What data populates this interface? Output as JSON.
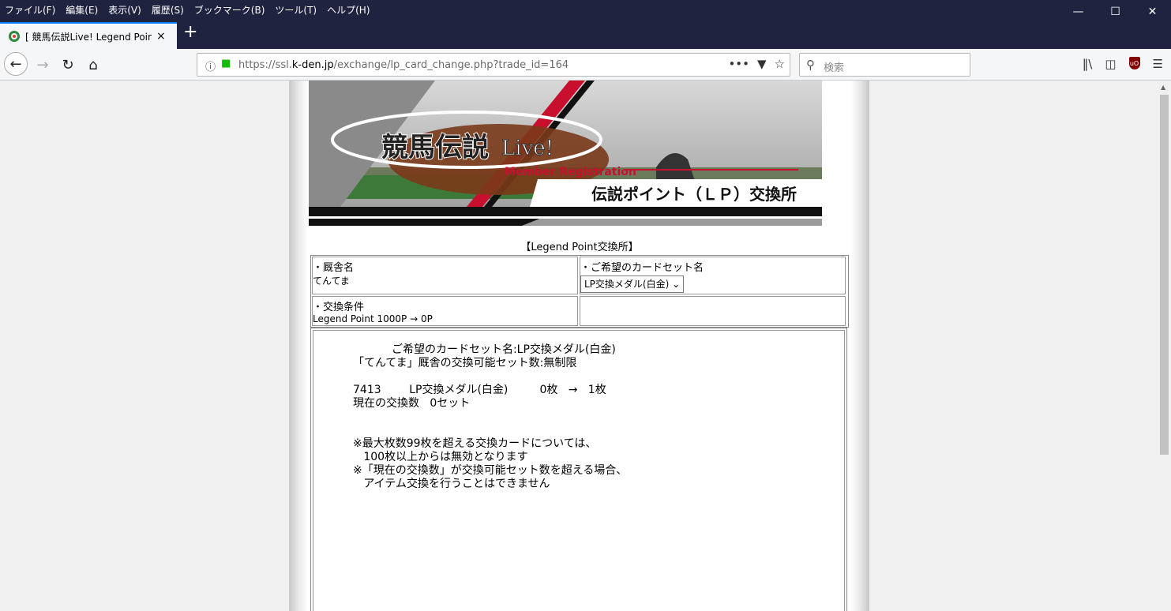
{
  "menu": [
    "ファイル(F)",
    "編集(E)",
    "表示(V)",
    "履歴(S)",
    "ブックマーク(B)",
    "ツール(T)",
    "ヘルプ(H)"
  ],
  "tab": {
    "title": "[ 競馬伝説Live! Legend Point交換",
    "close": "×"
  },
  "newtab": "+",
  "url": {
    "prefix": "https://ssl.",
    "domain": "k-den.jp",
    "path": "/exchange/lp_card_change.php?trade_id=164"
  },
  "search": {
    "placeholder": "検索"
  },
  "banner": {
    "logo": "競馬伝説",
    "live": "Live!",
    "subtitle": "Member Registration",
    "title": "伝説ポイント（ＬＰ）交換所"
  },
  "heading": "【Legend Point交換所】",
  "form": {
    "stable_label": "・厩舎名",
    "stable_value": "てんてま",
    "cardset_label": "・ご希望のカードセット名",
    "cardset_selected": "LP交換メダル(白金)",
    "condition_label": "・交換条件",
    "condition_value": "Legend Point 1000P → 0P"
  },
  "message": {
    "line1": "           ご希望のカードセット名:LP交換メダル(白金)",
    "line2": "「てんてま」厩舎の交換可能セット数:無制限",
    "line3": "",
    "line4": "7413        LP交換メダル(白金)         0枚   →   1枚",
    "line5": "現在の交換数   0セット",
    "line6": "",
    "line7": "",
    "line8": "※最大枚数99枚を超える交換カードについては、",
    "line9": "   100枚以上からは無効となります",
    "line10": "※「現在の交換数」が交換可能セット数を超える場合、",
    "line11": "   アイテム交換を行うことはできません"
  }
}
